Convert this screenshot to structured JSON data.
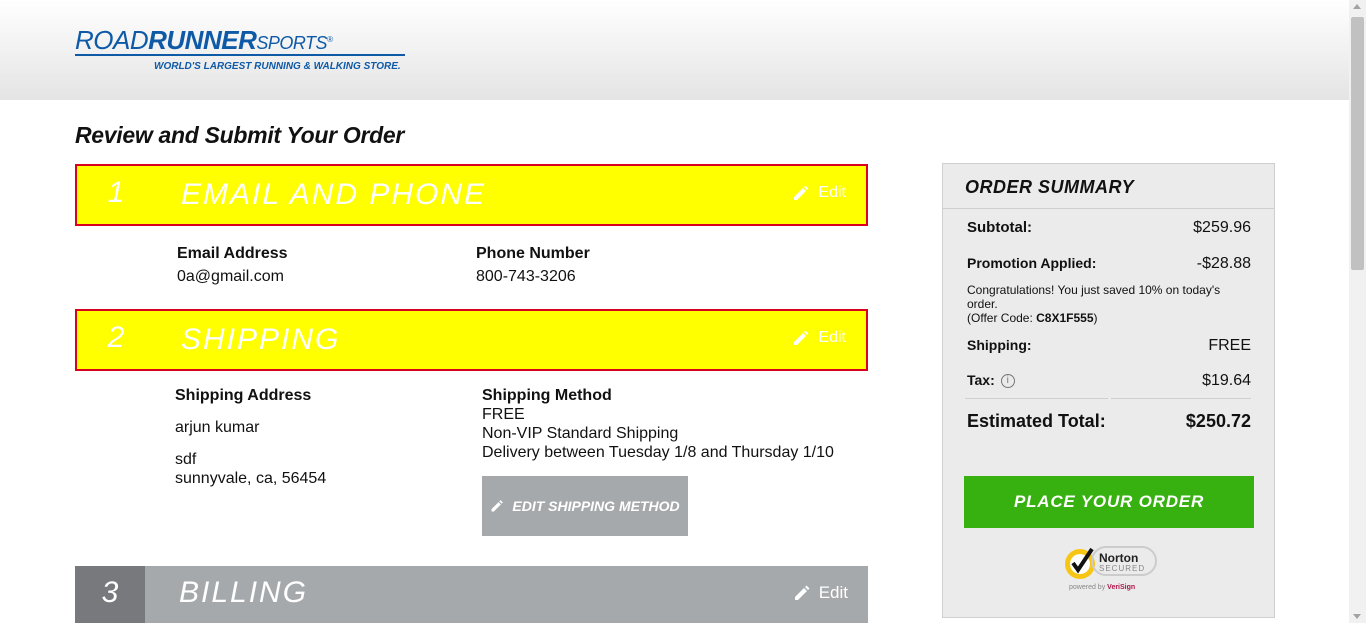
{
  "brand": {
    "logo_road": "ROAD",
    "logo_runner": "RUNNER",
    "logo_sports": "SPORTS",
    "logo_reg": "®",
    "tagline": "WORLD'S LARGEST RUNNING & WALKING STORE."
  },
  "page_title": "Review and Submit Your Order",
  "steps": [
    {
      "number": "1",
      "title": "EMAIL AND PHONE",
      "edit_label": "Edit"
    },
    {
      "number": "2",
      "title": "SHIPPING",
      "edit_label": "Edit"
    },
    {
      "number": "3",
      "title": "BILLING",
      "edit_label": "Edit"
    }
  ],
  "contact": {
    "email_label": "Email Address",
    "email_value": "0a@gmail.com",
    "phone_label": "Phone Number",
    "phone_value": "800-743-3206"
  },
  "shipping": {
    "address_label": "Shipping Address",
    "name": "arjun kumar",
    "street": "sdf",
    "city_line": "sunnyvale, ca, 56454",
    "method_label": "Shipping Method",
    "method_price": "FREE",
    "method_name": "Non-VIP Standard Shipping",
    "delivery": "Delivery between Tuesday 1/8 and Thursday 1/10",
    "edit_method_button": "EDIT SHIPPING METHOD"
  },
  "summary": {
    "title": "ORDER SUMMARY",
    "subtotal_label": "Subtotal:",
    "subtotal_value": "$259.96",
    "promo_label": "Promotion Applied:",
    "promo_value": "-$28.88",
    "promo_note": "Congratulations! You just saved 10% on today's order.",
    "offer_prefix": "(Offer Code: ",
    "offer_code": "C8X1F555",
    "offer_suffix": ")",
    "shipping_label": "Shipping:",
    "shipping_value": "FREE",
    "tax_label": "Tax:",
    "tax_value": "$19.64",
    "total_label": "Estimated Total:",
    "total_value": "$250.72",
    "place_order_button": "PLACE YOUR ORDER"
  },
  "norton": {
    "name": "Norton",
    "secured": "SECURED",
    "powered_by": "powered by",
    "verisign": "VeriSign"
  },
  "colors": {
    "brand_blue": "#0e5aa7",
    "step_yellow": "#ffff00",
    "step_border": "#d9001f",
    "place_order_green": "#36b110",
    "step_gray": "#a6a9ac"
  }
}
